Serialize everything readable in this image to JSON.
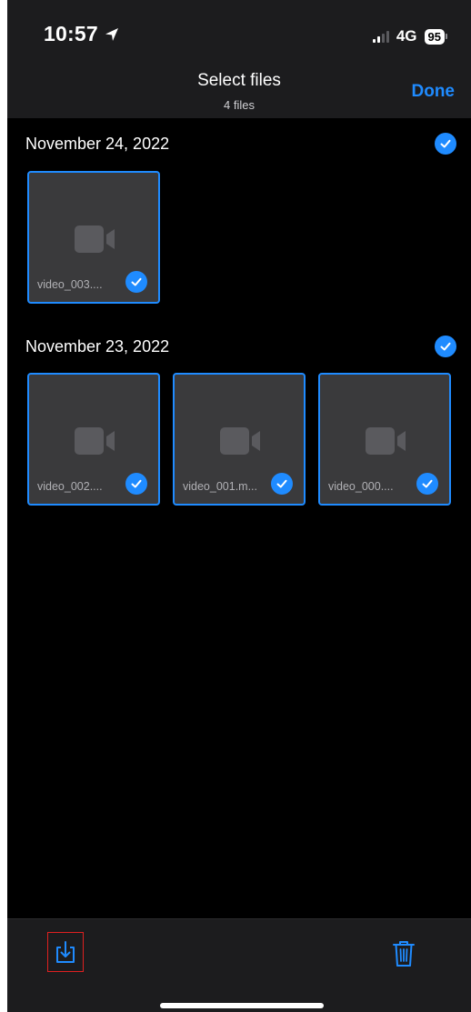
{
  "status_bar": {
    "time": "10:57",
    "network": "4G",
    "battery": "95"
  },
  "header": {
    "title": "Select files",
    "subtitle": "4 files",
    "done_label": "Done"
  },
  "sections": [
    {
      "date": "November 24, 2022",
      "files": [
        {
          "label": "video_003....",
          "selected": true
        }
      ]
    },
    {
      "date": "November 23, 2022",
      "files": [
        {
          "label": "video_002....",
          "selected": true
        },
        {
          "label": "video_001.m...",
          "selected": true
        },
        {
          "label": "video_000....",
          "selected": true
        }
      ]
    }
  ],
  "toolbar": {
    "export_icon": "export-download-icon",
    "delete_icon": "trash-icon"
  },
  "colors": {
    "accent": "#1f8bff",
    "background": "#000000",
    "bar": "#1c1c1e",
    "tile": "#3a3a3c",
    "highlight_box": "#e02020"
  }
}
